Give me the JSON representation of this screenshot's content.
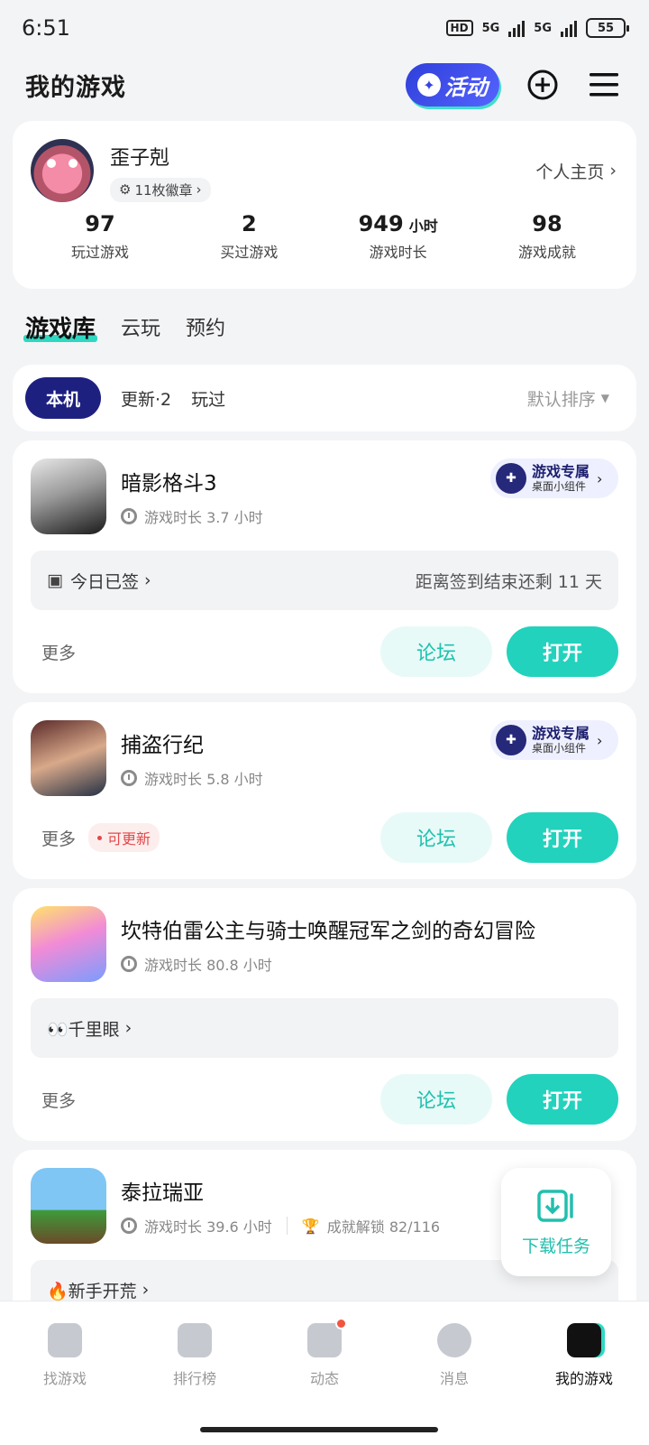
{
  "status_bar": {
    "time": "6:51",
    "hd": "HD",
    "network1": "5G",
    "network2": "5G",
    "battery": "55"
  },
  "header": {
    "title": "我的游戏",
    "activity_label": "活动"
  },
  "profile": {
    "name": "歪子剋",
    "badges": "11枚徽章",
    "homepage_link": "个人主页",
    "stats": [
      {
        "value": "97",
        "unit": "",
        "label": "玩过游戏"
      },
      {
        "value": "2",
        "unit": "",
        "label": "买过游戏"
      },
      {
        "value": "949",
        "unit": "小时",
        "label": "游戏时长"
      },
      {
        "value": "98",
        "unit": "",
        "label": "游戏成就"
      }
    ]
  },
  "library_tabs": [
    "游戏库",
    "云玩",
    "预约"
  ],
  "filters": {
    "chips": [
      "本机",
      "更新·2",
      "玩过"
    ],
    "sort": "默认排序"
  },
  "widget": {
    "title": "游戏专属",
    "subtitle": "桌面小组件"
  },
  "games": [
    {
      "name": "暗影格斗3",
      "time": "游戏时长 3.7 小时",
      "panel_left": "今日已签",
      "panel_right": "距离签到结束还剩 11 天",
      "more": "更多",
      "forum": "论坛",
      "open": "打开"
    },
    {
      "name": "捕盗行纪",
      "time": "游戏时长 5.8 小时",
      "more": "更多",
      "update_tag": "可更新",
      "forum": "论坛",
      "open": "打开"
    },
    {
      "name": "坎特伯雷公主与骑士唤醒冠军之剑的奇幻冒险",
      "time": "游戏时长 80.8 小时",
      "panel_left": "👀千里眼",
      "more": "更多",
      "forum": "论坛",
      "open": "打开"
    },
    {
      "name": "泰拉瑞亚",
      "time": "游戏时长 39.6 小时",
      "achievement": "成就解锁 82/116",
      "panel_left": "🔥新手开荒"
    }
  ],
  "download_fab": {
    "label": "下载任务"
  },
  "bottom_nav": [
    "找游戏",
    "排行榜",
    "动态",
    "消息",
    "我的游戏"
  ]
}
